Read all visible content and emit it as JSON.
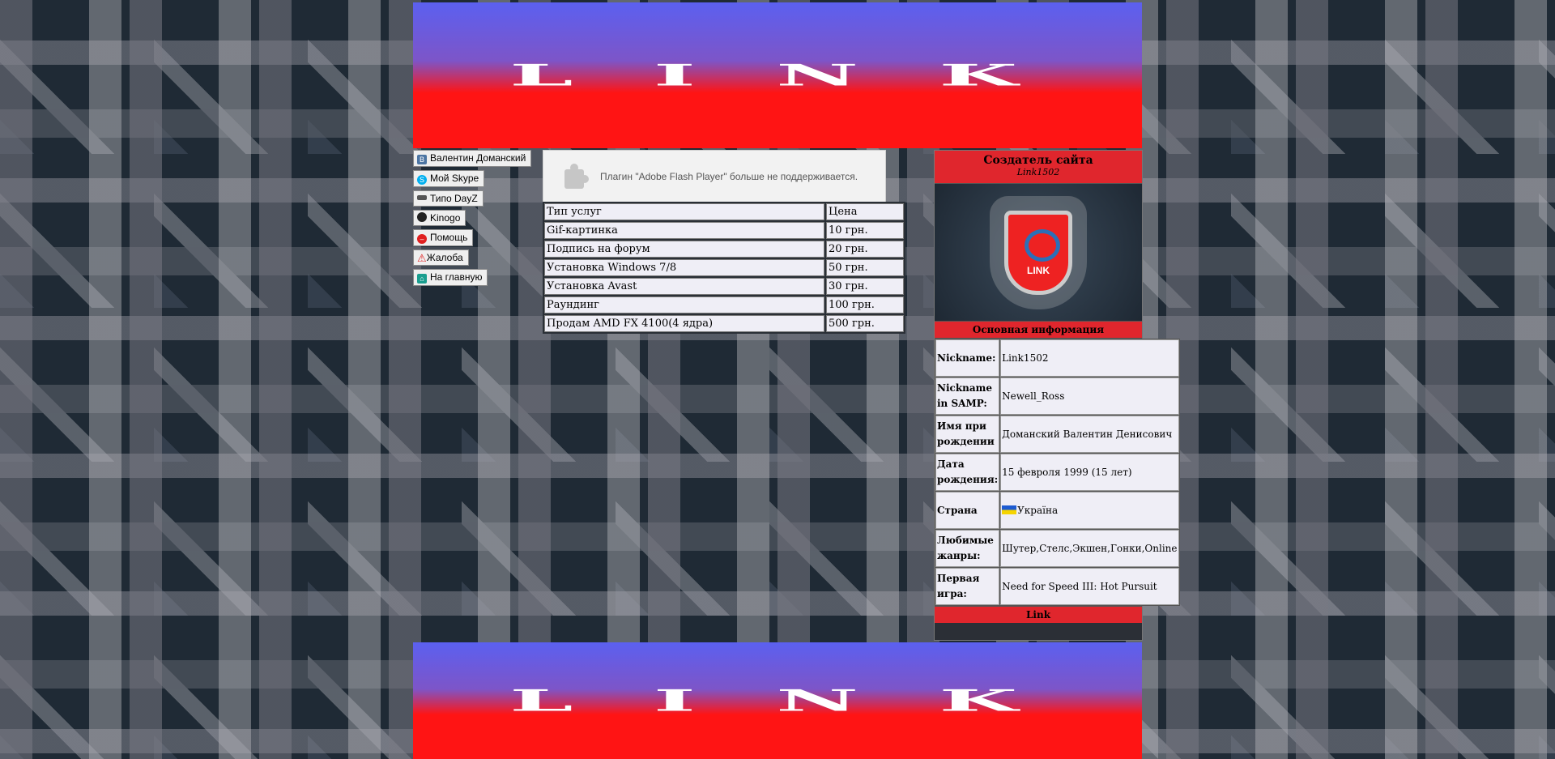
{
  "banner": {
    "text": "LINK"
  },
  "sidebar": {
    "items": [
      {
        "label": "Валентин Доманский",
        "icon": "vk-icon",
        "color": "#4c75a3"
      },
      {
        "label": "Мой Skype",
        "icon": "skype-icon",
        "color": "#00aff0"
      },
      {
        "label": "Типо DayZ",
        "icon": "gun-icon",
        "color": "#555555"
      },
      {
        "label": "Kinogo",
        "icon": "kinogo-icon",
        "color": "#222222"
      },
      {
        "label": "Помощь",
        "icon": "help-icon",
        "color": "#e02020"
      },
      {
        "label": "Жалоба",
        "icon": "warning-icon",
        "color": "#e02020"
      },
      {
        "label": "На главную",
        "icon": "home-icon",
        "color": "#1a9e8f"
      }
    ]
  },
  "flash": {
    "message": "Плагин \"Adobe Flash Player\" больше не поддерживается."
  },
  "services": {
    "headers": [
      "Тип услуг",
      "Цена"
    ],
    "rows": [
      [
        "Gif-картинка",
        "10 грн."
      ],
      [
        "Подпись на форум",
        "20 грн."
      ],
      [
        "Установка Windows 7/8",
        "50 грн."
      ],
      [
        "Установка Avast",
        "30 грн."
      ],
      [
        "Раундинг",
        "100 грн."
      ],
      [
        "Продам AMD FX 4100(4 ядра)",
        "500 грн."
      ]
    ]
  },
  "profile": {
    "title": "Создатель сайта",
    "subtitle": "Link1502",
    "logo_text": "LINK",
    "section": "Основная информация",
    "rows": [
      {
        "key": "Nickname:",
        "value": "Link1502"
      },
      {
        "key": "Nickname in SAMP:",
        "value": "Newell_Ross"
      },
      {
        "key": "Имя при рождении",
        "value": "Доманский Валентин Денисович"
      },
      {
        "key": "Дата рождения:",
        "value": "15 февроля 1999 (15 лет)"
      },
      {
        "key": "Страна",
        "value": "Україна"
      },
      {
        "key": "Любимые жанры:",
        "value": "Шутер,Стелс,Экшен,Гонки,Online"
      },
      {
        "key": "Первая игра:",
        "value": "Need for Speed III: Hot Pursuit"
      }
    ],
    "footer": "Link"
  }
}
